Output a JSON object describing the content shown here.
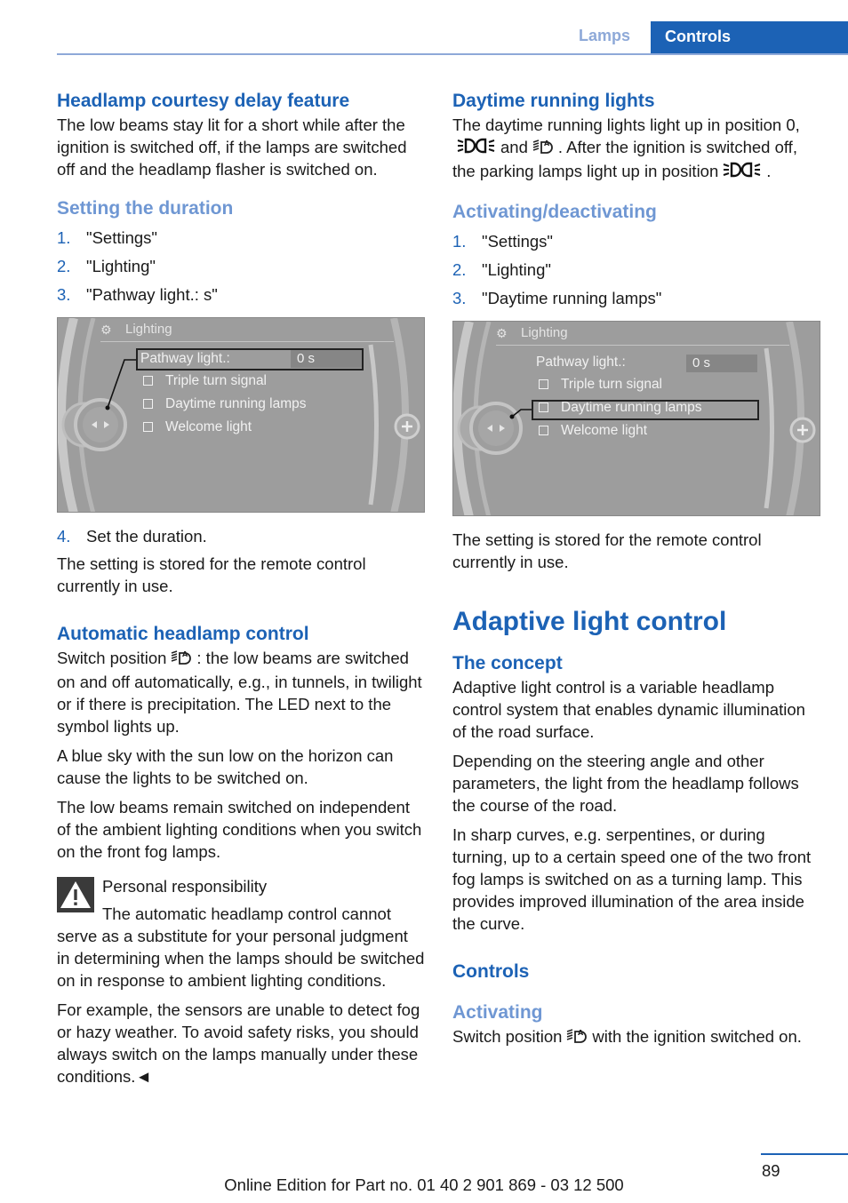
{
  "header": {
    "tab_lamps": "Lamps",
    "tab_controls": "Controls"
  },
  "left": {
    "courtesy_title": "Headlamp courtesy delay feature",
    "courtesy_text": "The low beams stay lit for a short while after the ignition is switched off, if the lamps are switched off and the headlamp flasher is switched on.",
    "duration_title": "Setting the duration",
    "steps": [
      {
        "num": "1.",
        "text": "\"Settings\""
      },
      {
        "num": "2.",
        "text": "\"Lighting\""
      },
      {
        "num": "3.",
        "text": "\"Pathway light.: s\""
      }
    ],
    "step4": {
      "num": "4.",
      "text": "Set the duration."
    },
    "stored_text": "The setting is stored for the remote control currently in use.",
    "auto_title": "Automatic headlamp control",
    "auto_p1_a": "Switch position",
    "auto_p1_b": ": the low beams are switched on and off automatically, e.g., in tunnels, in twilight or if there is precipitation. The LED next to the symbol lights up.",
    "auto_p2": "A blue sky with the sun low on the horizon can cause the lights to be switched on.",
    "auto_p3": "The low beams remain switched on independent of the ambient lighting conditions when you switch on the front fog lamps.",
    "warning_title": "Personal responsibility",
    "warning_text": "The automatic headlamp control cannot serve as a substitute for your personal judgment in determining when the lamps should be switched on in response to ambient lighting conditions.",
    "warning_p2": "For example, the sensors are unable to detect fog or hazy weather. To avoid safety risks, you should always switch on the lamps manually under these conditions.◄"
  },
  "screen1": {
    "title": "Lighting",
    "pathway_label": "Pathway light.:",
    "pathway_value": "0 s",
    "options": [
      "Triple turn signal",
      "Daytime running lamps",
      "Welcome light"
    ],
    "selected": "Pathway light.:"
  },
  "screen2": {
    "title": "Lighting",
    "pathway_label": "Pathway light.:",
    "pathway_value": "0 s",
    "options": [
      "Triple turn signal",
      "Daytime running lamps",
      "Welcome light"
    ],
    "selected": "Daytime running lamps"
  },
  "right": {
    "drl_title": "Daytime running lights",
    "drl_a": "The daytime running lights light up in position 0,",
    "drl_b": "and",
    "drl_c": ". After the ignition is switched off, the parking lamps light up in position",
    "drl_d": ".",
    "act_title": "Activating/deactivating",
    "steps": [
      {
        "num": "1.",
        "text": "\"Settings\""
      },
      {
        "num": "2.",
        "text": "\"Lighting\""
      },
      {
        "num": "3.",
        "text": "\"Daytime running lamps\""
      }
    ],
    "stored_text": "The setting is stored for the remote control currently in use.",
    "alc_title": "Adaptive light control",
    "concept_title": "The concept",
    "concept_p1": "Adaptive light control is a variable headlamp control system that enables dynamic illumination of the road surface.",
    "concept_p2": "Depending on the steering angle and other parameters, the light from the headlamp follows the course of the road.",
    "concept_p3": "In sharp curves, e.g. serpentines, or during turning, up to a certain speed one of the two front fog lamps is switched on as a turning lamp. This provides improved illumination of the area inside the curve.",
    "controls_title": "Controls",
    "activating_title": "Activating",
    "activating_a": "Switch position",
    "activating_b": "with the ignition switched on."
  },
  "footer": {
    "edition": "Online Edition for Part no. 01 40 2 901 869 - 03 12 500",
    "page": "89"
  }
}
